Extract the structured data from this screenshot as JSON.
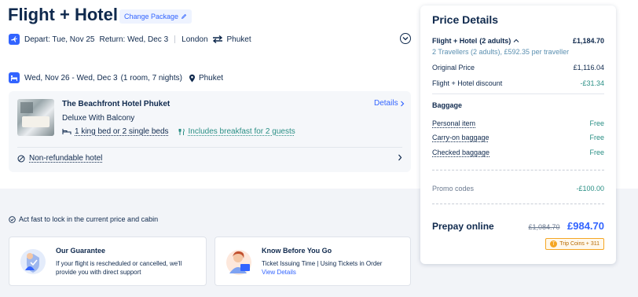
{
  "header": {
    "title": "Flight + Hotel",
    "change_package": "Change Package"
  },
  "flight": {
    "depart": "Depart: Tue, Nov 25",
    "return": "Return: Wed, Dec 3",
    "origin": "London",
    "destination": "Phuket"
  },
  "hotel": {
    "dates": "Wed, Nov 26 - Wed, Dec 3",
    "stay": "(1 room, 7 nights)",
    "city": "Phuket",
    "name": "The Beachfront Hotel Phuket",
    "details_label": "Details",
    "room": "Deluxe With Balcony",
    "beds": "1 king bed or 2 single beds",
    "breakfast": "Includes breakfast for 2 guests",
    "refund_policy": "Non-refundable hotel"
  },
  "notice": {
    "act_fast": "Act fast to lock in the current price and cabin"
  },
  "cards": {
    "guarantee_title": "Our Guarantee",
    "guarantee_text_1": "If your flight is rescheduled or cancelled, we'll",
    "guarantee_text_2": "provide you with direct support",
    "know_title": "Know Before You Go",
    "know_text": "Ticket Issuing Time | Using Tickets in Order",
    "know_link": "View Details"
  },
  "price": {
    "title": "Price Details",
    "package_label": "Flight + Hotel",
    "package_count": "(2 adults)",
    "package_amount": "£1,184.70",
    "travellers_line": "2 Travellers  (2 adults), £592.35 per traveller",
    "original_label": "Original Price",
    "original_amount": "£1,116.04",
    "discount_label": "Flight + Hotel discount",
    "discount_amount": "-£31.34",
    "baggage_heading": "Baggage",
    "baggage": [
      {
        "label": "Personal item",
        "value": "Free"
      },
      {
        "label": "Carry-on baggage",
        "value": "Free"
      },
      {
        "label": "Checked baggage",
        "value": "Free"
      }
    ],
    "promo_label": "Promo codes",
    "promo_amount": "-£100.00",
    "prepay_label": "Prepay online",
    "prepay_original": "£1,084.70",
    "prepay_final": "£984.70",
    "coins_label": "Trip Coins + 311"
  },
  "colors": {
    "accent": "#3264ff",
    "text": "#0f294d",
    "discount": "#2a8f85",
    "coins": "#f5a623"
  }
}
